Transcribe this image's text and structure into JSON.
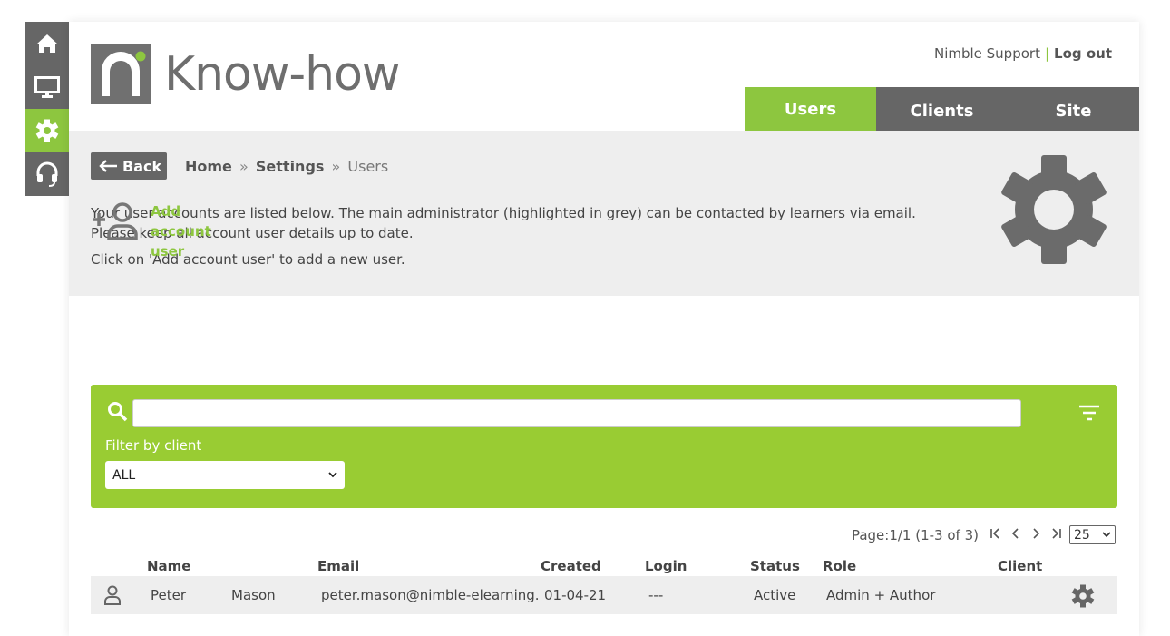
{
  "rail": [
    {
      "icon": "home-icon"
    },
    {
      "icon": "monitor-icon"
    },
    {
      "icon": "gear-icon",
      "active": true
    },
    {
      "icon": "headset-icon"
    }
  ],
  "brand": {
    "name": "Know-how",
    "accent": "#8dc63f",
    "grey": "#666666"
  },
  "toplinks": {
    "support": "Nimble Support",
    "separator": "|",
    "logout": "Log out"
  },
  "tabs": [
    {
      "label": "Users",
      "active": true
    },
    {
      "label": "Clients"
    },
    {
      "label": "Site"
    }
  ],
  "back_label": "Back",
  "breadcrumb": {
    "home": "Home",
    "settings": "Settings",
    "current": "Users",
    "sep": "»"
  },
  "intro": {
    "line1": "Your user accounts are listed below. The main administrator (highlighted in grey) can be contacted by learners via email.",
    "line2": "Please keep all account user details up to date.",
    "line3": "Click on 'Add account user' to add a new user."
  },
  "add_user": {
    "line1": "Add",
    "line2": "account",
    "line3": "user"
  },
  "search": {
    "value": "",
    "placeholder": ""
  },
  "filter": {
    "label": "Filter by client",
    "selected": "ALL"
  },
  "pager": {
    "text": "Page:1/1 (1-3 of 3)",
    "page_size": "25"
  },
  "table": {
    "headers": {
      "name": "Name",
      "email": "Email",
      "created": "Created",
      "login": "Login",
      "status": "Status",
      "role": "Role",
      "client": "Client"
    },
    "rows": [
      {
        "first": "Peter",
        "last": "Mason",
        "email": "peter.mason@nimble-elearning.",
        "created": "01-04-21",
        "login": "---",
        "status": "Active",
        "role": "Admin + Author",
        "client": ""
      }
    ]
  }
}
